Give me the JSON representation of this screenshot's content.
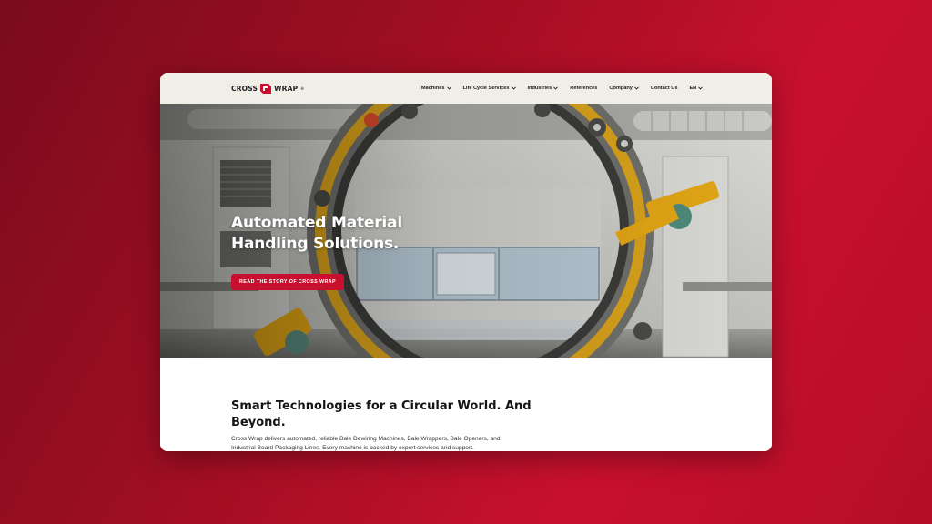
{
  "brand": {
    "name_left": "CROSS",
    "name_right": "WRAP",
    "trademark": "®",
    "accent": "#c8102e"
  },
  "nav": {
    "items": [
      {
        "label": "Machines",
        "dropdown": true
      },
      {
        "label": "Life Cycle Services",
        "dropdown": true
      },
      {
        "label": "Industries",
        "dropdown": true
      },
      {
        "label": "References",
        "dropdown": false
      },
      {
        "label": "Company",
        "dropdown": true
      },
      {
        "label": "Contact Us",
        "dropdown": false
      },
      {
        "label": "EN",
        "dropdown": true
      }
    ]
  },
  "hero": {
    "title_line1": "Automated Material",
    "title_line2": "Handling Solutions.",
    "cta_label": "READ THE STORY OF CROSS WRAP",
    "image": "industrial-ring-wrapping-machine"
  },
  "intro": {
    "heading_line1": "Smart Technologies for a Circular World. And",
    "heading_line2": "Beyond.",
    "body_line1": "Cross Wrap delivers automated, reliable Bale Dewiring Machines, Bale Wrappers, Bale Openers, and",
    "body_line2": "Industrial Board Packaging Lines. Every machine is backed by expert services and support."
  }
}
